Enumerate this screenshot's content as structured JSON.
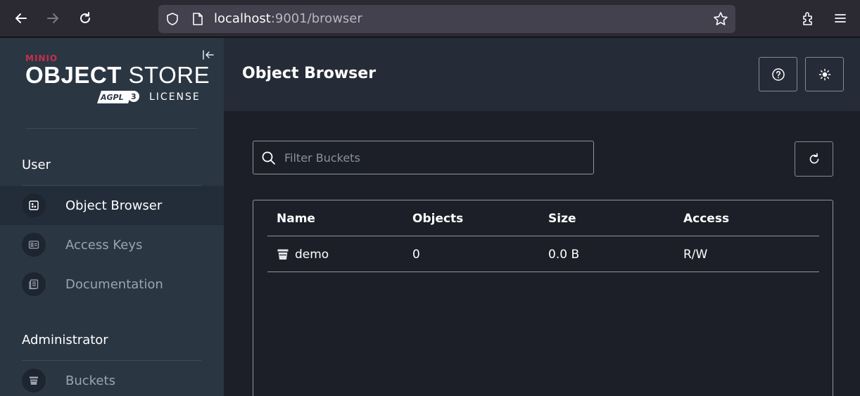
{
  "browser": {
    "url_host": "localhost",
    "url_rest": ":9001/browser",
    "icons": [
      "back-icon",
      "forward-icon",
      "reload-icon",
      "shield-icon",
      "page-icon",
      "bookmark-star-icon",
      "extensions-icon",
      "menu-icon"
    ]
  },
  "sidebar": {
    "logo_brand": "MINIO",
    "logo_product_bold": "OBJECT",
    "logo_product_light": "STORE",
    "logo_agpl": "AGPL",
    "logo_license": "LICENSE",
    "sections": [
      {
        "title": "User",
        "items": [
          {
            "label": "Object Browser",
            "icon": "object-browser-icon",
            "active": true
          },
          {
            "label": "Access Keys",
            "icon": "access-keys-icon",
            "active": false
          },
          {
            "label": "Documentation",
            "icon": "documentation-icon",
            "active": false
          }
        ]
      },
      {
        "title": "Administrator",
        "items": [
          {
            "label": "Buckets",
            "icon": "bucket-icon",
            "active": false
          }
        ]
      }
    ]
  },
  "main": {
    "title": "Object Browser",
    "search_placeholder": "Filter Buckets",
    "table": {
      "headers": [
        "Name",
        "Objects",
        "Size",
        "Access"
      ],
      "rows": [
        {
          "name": "demo",
          "objects": "0",
          "size": "0.0 B",
          "access": "R/W"
        }
      ]
    }
  },
  "colors": {
    "accent": "#c72e49",
    "sidebar_bg": "#2b3643",
    "main_bg": "#1c1f27"
  }
}
